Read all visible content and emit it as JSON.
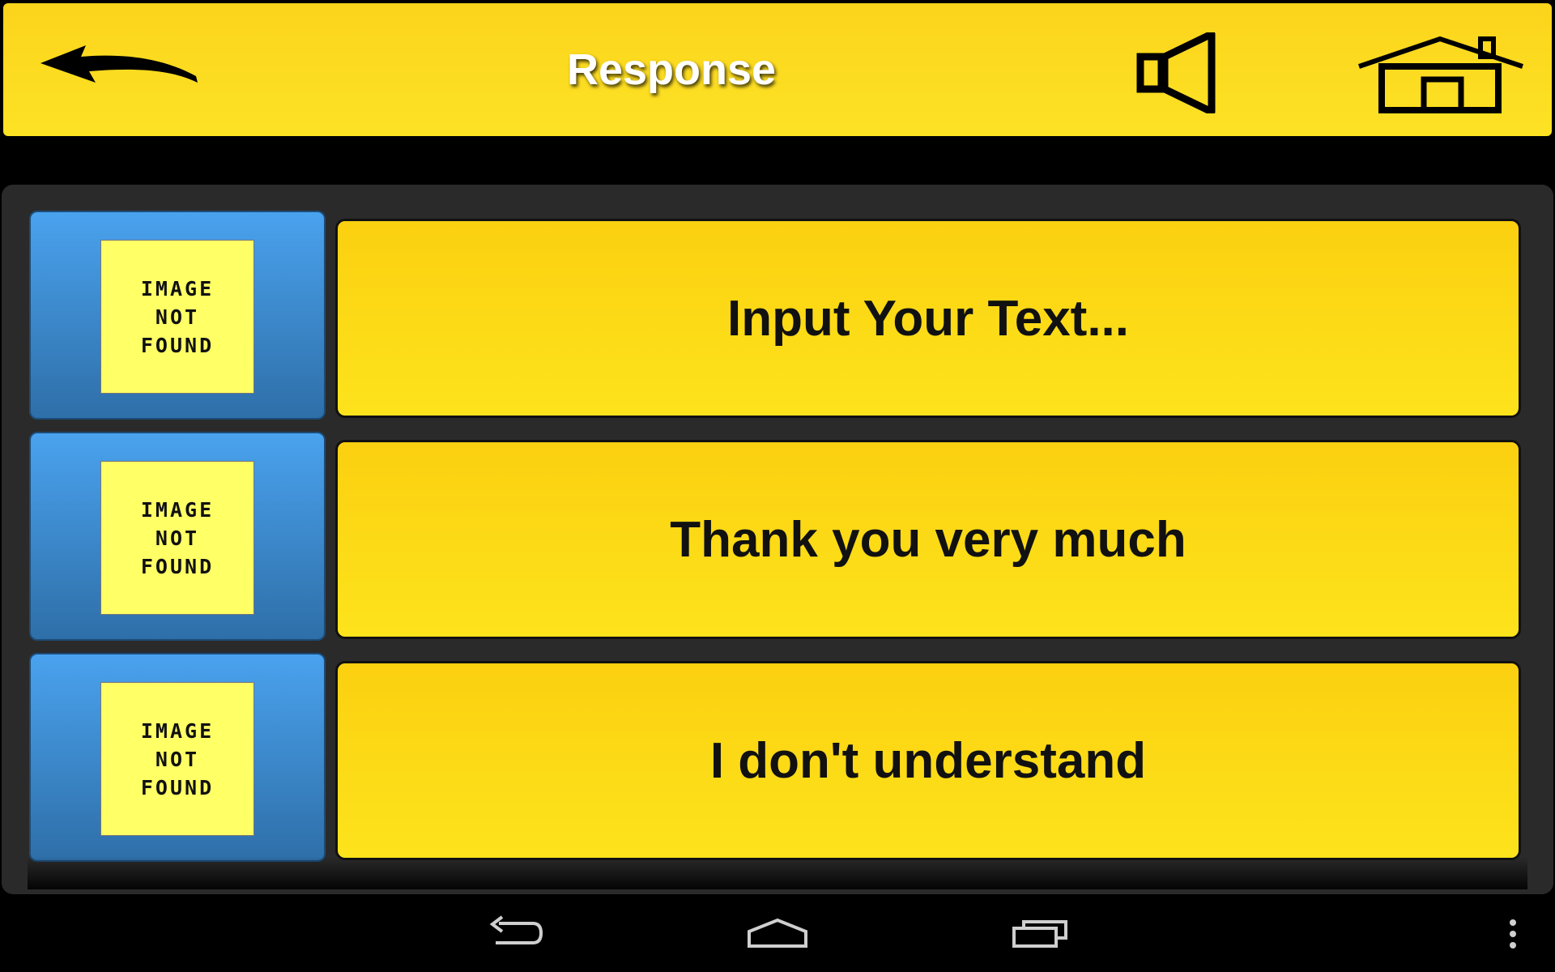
{
  "header": {
    "title": "Response",
    "back_icon": "back-arrow-icon",
    "speaker_icon": "speaker-icon",
    "home_icon": "home-icon",
    "bar_color": "#fcd81f",
    "title_color": "#ffffff"
  },
  "responses": [
    {
      "placeholder_text": [
        "IMAGE",
        "NOT",
        "FOUND"
      ],
      "label": "Input Your Text..."
    },
    {
      "placeholder_text": [
        "IMAGE",
        "NOT",
        "FOUND"
      ],
      "label": "Thank you very much"
    },
    {
      "placeholder_text": [
        "IMAGE",
        "NOT",
        "FOUND"
      ],
      "label": "I don't understand"
    }
  ],
  "colors": {
    "tile_blue": "#3d8fd8",
    "phrase_yellow": "#fcd714",
    "placeholder_yellow": "#ffff66"
  },
  "system_nav": {
    "back_icon": "system-back-icon",
    "home_icon": "system-home-icon",
    "recents_icon": "recent-apps-icon",
    "menu_icon": "overflow-menu-icon"
  }
}
